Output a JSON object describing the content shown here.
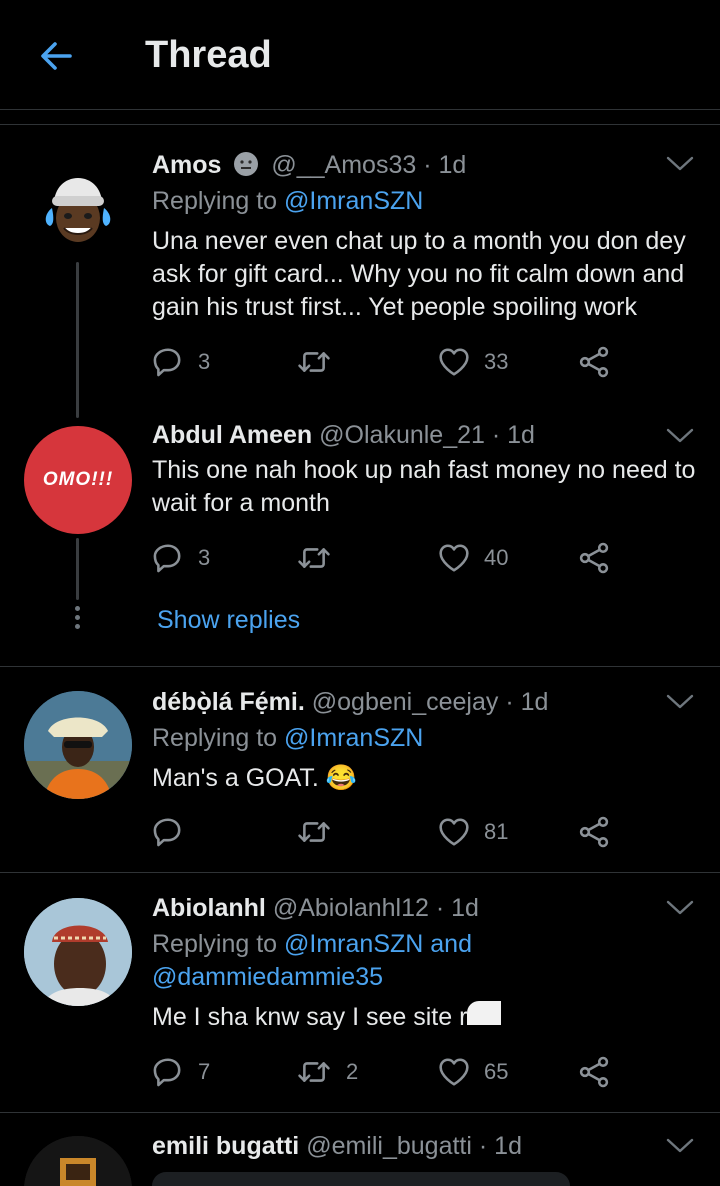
{
  "header": {
    "title": "Thread"
  },
  "tweets": [
    {
      "name": "Amos",
      "handle": "@__Amos33",
      "time": "· 1d",
      "replying_prefix": "Replying to",
      "replying_to": "@ImranSZN",
      "text": "Una never even chat up to a month you don dey ask for gift card... Why you no fit calm down and gain his trust first... Yet people spoiling work",
      "replies": "3",
      "likes": "33"
    },
    {
      "name": "Abdul Ameen",
      "handle": "@Olakunle_21",
      "time": "· 1d",
      "avatar_text": "OMO!!!",
      "text": "This one nah hook up nah fast money no need to wait for a month",
      "replies": "3",
      "likes": "40"
    },
    {
      "name": "débọ̀lá Fẹ́mi.",
      "handle": "@ogbeni_ceejay",
      "time": "· 1d",
      "replying_prefix": "Replying to",
      "replying_to": "@ImranSZN",
      "text": "Man's a GOAT. 😂",
      "likes": "81"
    },
    {
      "name": "Abiolanhl",
      "handle": "@Abiolanhl12",
      "time": "· 1d",
      "replying_prefix": "Replying to",
      "replying_to": "@ImranSZN and",
      "replying_to_2": "@dammiedammie35",
      "text": "Me I sha knw say I see site r",
      "replies": "7",
      "retweets": "2",
      "likes": "65"
    },
    {
      "name": "emili bugatti",
      "handle": "@emili_bugatti",
      "time": "· 1d"
    }
  ],
  "show_replies_label": "Show replies",
  "icons": {
    "back": "arrow-left-icon",
    "reply": "reply-icon",
    "retweet": "retweet-icon",
    "like": "heart-icon",
    "share": "share-icon",
    "more": "chevron-down-icon"
  },
  "colors": {
    "accent": "#4ba3ef",
    "background": "#000000",
    "muted": "#8b9197"
  }
}
